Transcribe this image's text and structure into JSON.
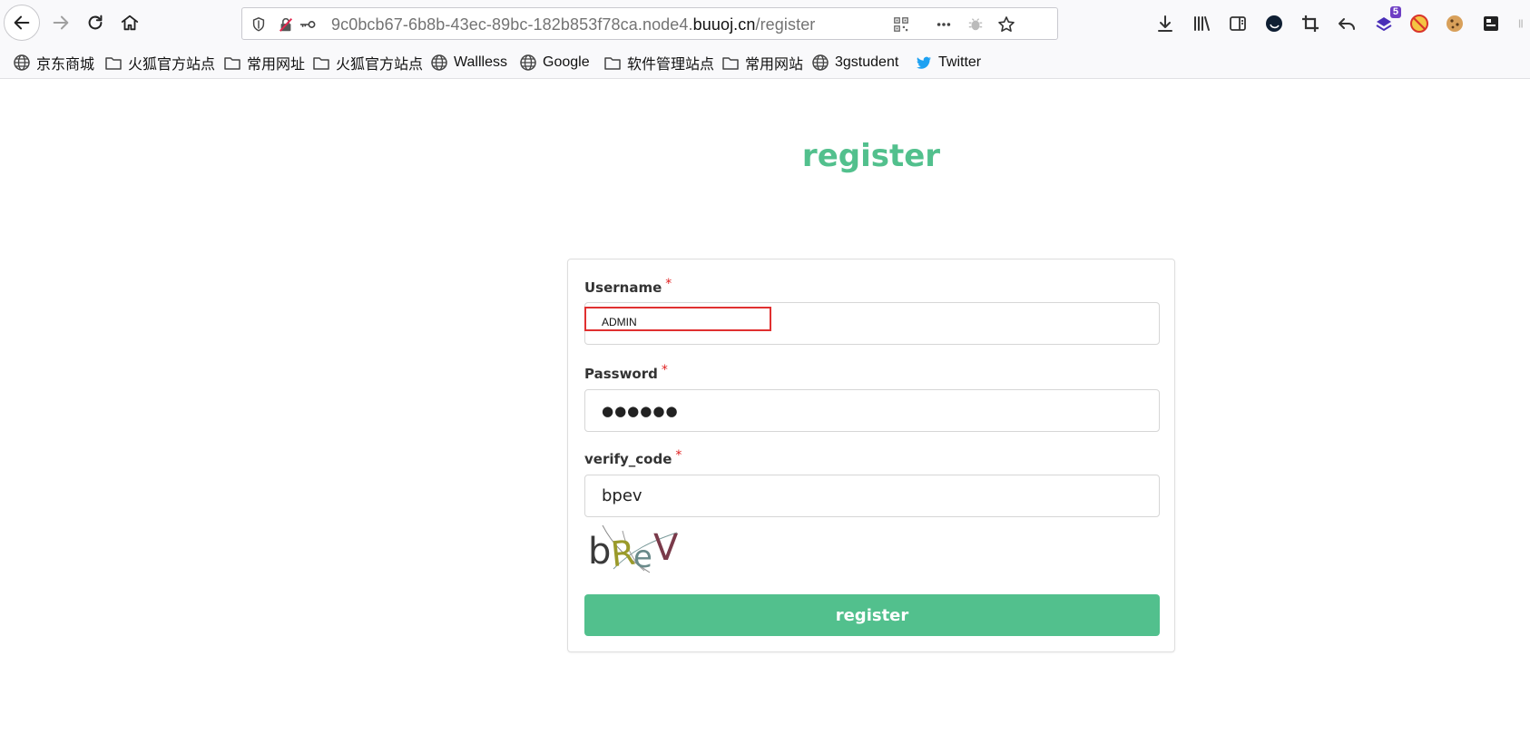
{
  "browser": {
    "url_prefix": "9c0bcb67-6b8b-43ec-89bc-182b853f78ca.node4.",
    "url_domain": "buuoj.cn",
    "url_path": "/register",
    "extension_badge": "5"
  },
  "bookmarks": [
    {
      "label": "京东商城",
      "icon": "globe-icon"
    },
    {
      "label": "火狐官方站点",
      "icon": "folder-icon"
    },
    {
      "label": "常用网址",
      "icon": "folder-icon"
    },
    {
      "label": "火狐官方站点",
      "icon": "folder-icon"
    },
    {
      "label": "Wallless",
      "icon": "globe-icon"
    },
    {
      "label": "Google",
      "icon": "globe-icon"
    },
    {
      "label": "软件管理站点",
      "icon": "folder-icon"
    },
    {
      "label": "常用网站",
      "icon": "folder-icon"
    },
    {
      "label": "3gstudent",
      "icon": "globe-icon"
    },
    {
      "label": "Twitter",
      "icon": "twitter-icon"
    }
  ],
  "page": {
    "title": "register",
    "required_mark": "*",
    "username": {
      "label": "Username",
      "value": "ADMIN"
    },
    "password": {
      "label": "Password",
      "value": "●●●●●●"
    },
    "verify_code": {
      "label": "verify_code",
      "value": "bpev"
    },
    "captcha_text": "bReV",
    "submit_label": "register"
  },
  "colors": {
    "accent": "#52c08d",
    "required": "#e02020",
    "highlight": "#e03030"
  }
}
